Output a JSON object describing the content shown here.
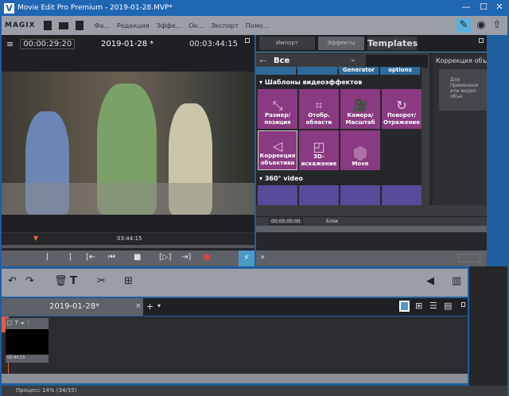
{
  "window": {
    "title": "Movie Edit Pro Premium - 2019-01-28.MVP*",
    "app_icon": "V",
    "controls": [
      "—",
      "☐",
      "✕"
    ]
  },
  "menubar": {
    "brand": "MAGIX",
    "items": [
      "Фа...",
      "Редакция",
      "Эффе...",
      "Ок...",
      "Экспорт",
      "Помо..."
    ]
  },
  "preview": {
    "timecode": "00:00:29:20",
    "project": "2019-01-28 *",
    "duration": "00:03:44:15",
    "ruler_time": "03:44:15",
    "transport": [
      "[",
      "]",
      "[⇤",
      "⏮",
      "■",
      "[▷]",
      "⇥]",
      "●",
      "⚡"
    ]
  },
  "effects": {
    "tabs": [
      "Импорт",
      "Эффекты",
      "Templates"
    ],
    "active_tab": "Эффекты",
    "category": "Все",
    "search_value": "",
    "top_row": [
      "",
      "",
      "Generator",
      "options"
    ],
    "section1": "Шаблоны видеоэффектов",
    "tiles": [
      {
        "label": "Размер/ позиция",
        "icon": "resize-icon"
      },
      {
        "label": "Отобр. области",
        "icon": "crop-icon"
      },
      {
        "label": "Камера/ Масштаб",
        "icon": "camera-icon"
      },
      {
        "label": "Поворот/ Отражение",
        "icon": "rotate-icon"
      },
      {
        "label": "Коррекция объектива",
        "icon": "lens-icon"
      },
      {
        "label": "3D- искажение",
        "icon": "distort-icon"
      },
      {
        "label": "Move",
        "icon": "hexagon-icon"
      }
    ],
    "section2": "360° video",
    "info_title": "Коррекция объек",
    "info_text": "Для применени или видео объе",
    "timecode": "00:00:00:00",
    "block_label": "Блок",
    "colors": {
      "tile": "#8a3a80",
      "tile360": "#5a4a9a",
      "accent": "#4a9ac8"
    }
  },
  "timeline": {
    "tab": "2019-01-28*",
    "clip_time": "03:44:15"
  },
  "status": {
    "text": "Процесс 14% (34/35)",
    "progress_percent": 14
  }
}
